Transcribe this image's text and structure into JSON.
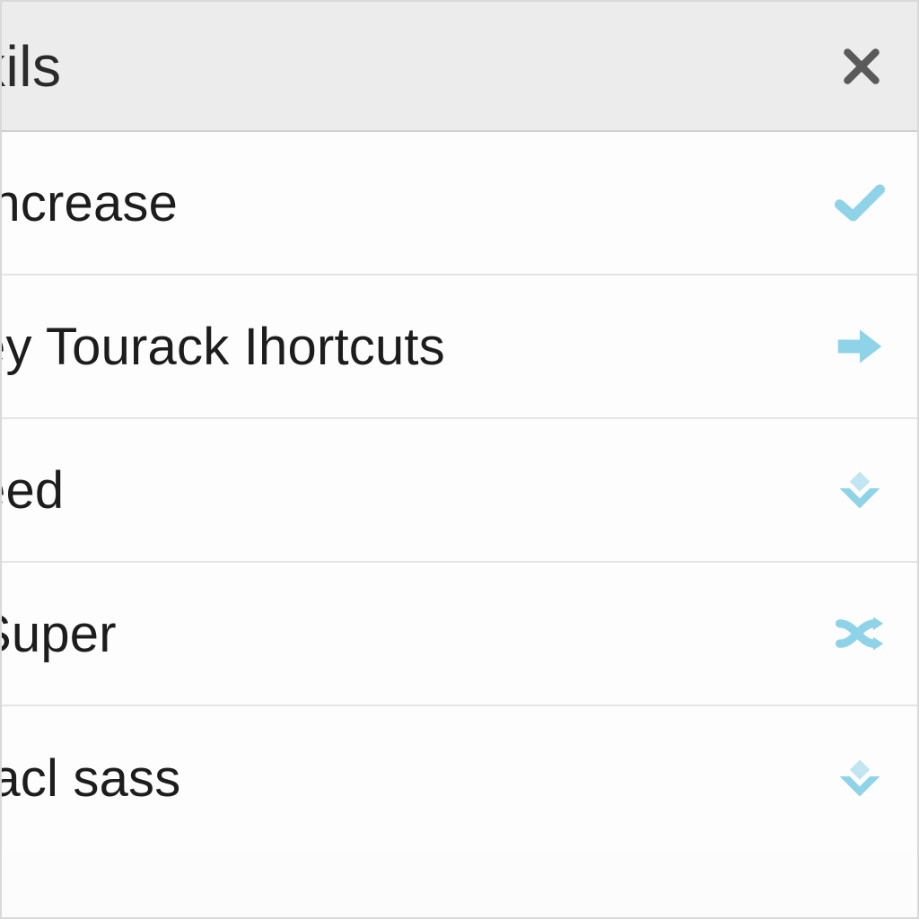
{
  "colors": {
    "accent": "#8fd3e8",
    "close_icon": "#5a5a5a",
    "header_bg": "#ececec",
    "row_bg": "#fdfdfd",
    "divider": "#e5e5e5",
    "text": "#1d1d1d"
  },
  "header": {
    "title": "kils"
  },
  "rows": [
    {
      "label": "Increase",
      "icon": "check-icon"
    },
    {
      "label": "ey Tourack Ihortcuts",
      "icon": "arrow-right-icon"
    },
    {
      "label": "eed",
      "icon": "chevron-down-icon"
    },
    {
      "label": "Super",
      "icon": "shuffle-icon"
    },
    {
      "label": "facl sass",
      "icon": "chevron-down-icon"
    }
  ]
}
